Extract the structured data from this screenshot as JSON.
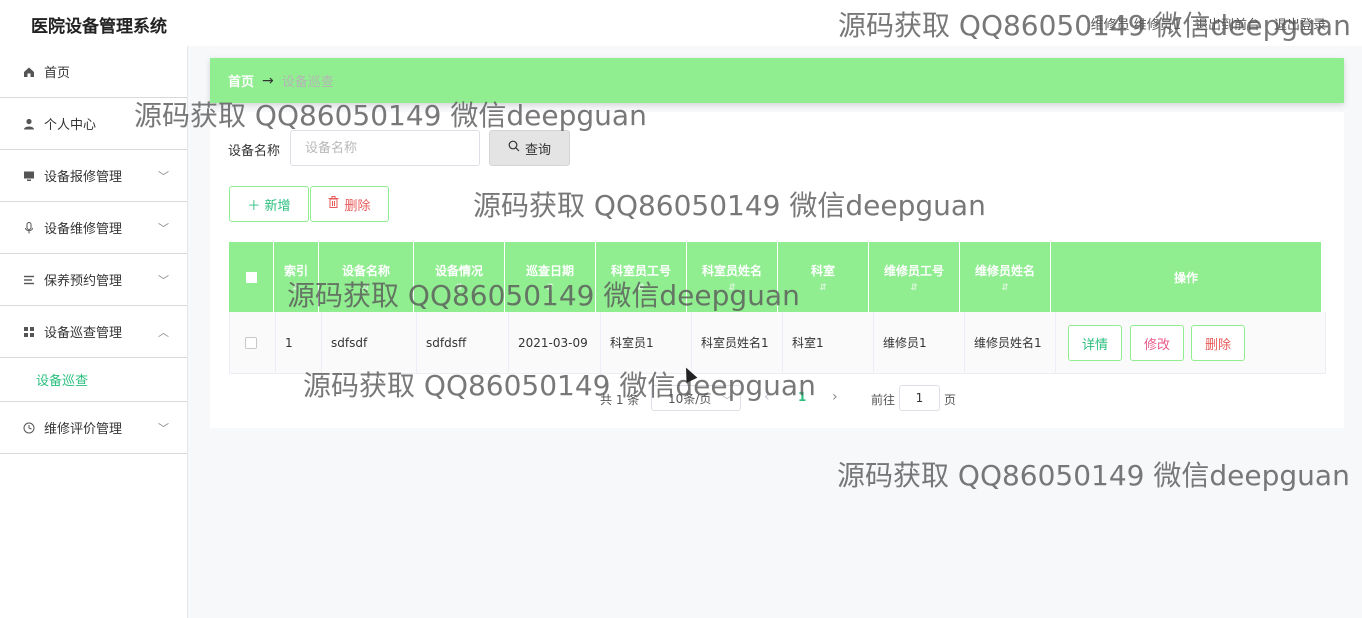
{
  "app": {
    "title": "医院设备管理系统"
  },
  "header": {
    "user_info": "维修员 维修员1",
    "back_home": "退出到前台",
    "logout": "退出登录"
  },
  "sidebar": {
    "items": [
      {
        "label": "首页",
        "icon": "home-icon"
      },
      {
        "label": "个人中心",
        "icon": "user-icon"
      },
      {
        "label": "设备报修管理",
        "icon": "monitor-icon",
        "expandable": true
      },
      {
        "label": "设备维修管理",
        "icon": "microphone-icon",
        "expandable": true
      },
      {
        "label": "保养预约管理",
        "icon": "list-icon",
        "expandable": true
      },
      {
        "label": "设备巡查管理",
        "icon": "grid-icon",
        "expandable": true,
        "expanded": true
      },
      {
        "label": "维修评价管理",
        "icon": "clock-icon",
        "expandable": true
      }
    ],
    "subitem": {
      "label": "设备巡查"
    }
  },
  "breadcrumb": {
    "home": "首页",
    "arrow": "→",
    "current": "设备巡查"
  },
  "search": {
    "label": "设备名称",
    "placeholder": "设备名称",
    "button": "查询"
  },
  "actions": {
    "add": "＋ 新增",
    "delete": "删除"
  },
  "table": {
    "columns": [
      "索引",
      "设备名称",
      "设备情况",
      "巡查日期",
      "科室员工号",
      "科室员姓名",
      "科室",
      "维修员工号",
      "维修员姓名",
      "操作"
    ],
    "rows": [
      {
        "index": "1",
        "device_name": "sdfsdf",
        "condition": "sdfdsff",
        "date": "2021-03-09",
        "staff_id": "科室员1",
        "staff_name": "科室员姓名1",
        "dept": "科室1",
        "repairer_id": "维修员1",
        "repairer_name": "维修员姓名1"
      }
    ],
    "row_actions": {
      "detail": "详情",
      "edit": "修改",
      "delete": "删除"
    }
  },
  "pagination": {
    "total": "共 1 条",
    "page_size": "10条/页",
    "current_page": "1",
    "goto_label": "前往",
    "goto_value": "1",
    "page_unit": "页"
  },
  "watermark": {
    "text": "源码获取 QQ86050149 微信deepguan"
  },
  "colors": {
    "accent": "#90ee90",
    "accent_text": "#2bbf7e",
    "danger": "#e85a5a"
  }
}
